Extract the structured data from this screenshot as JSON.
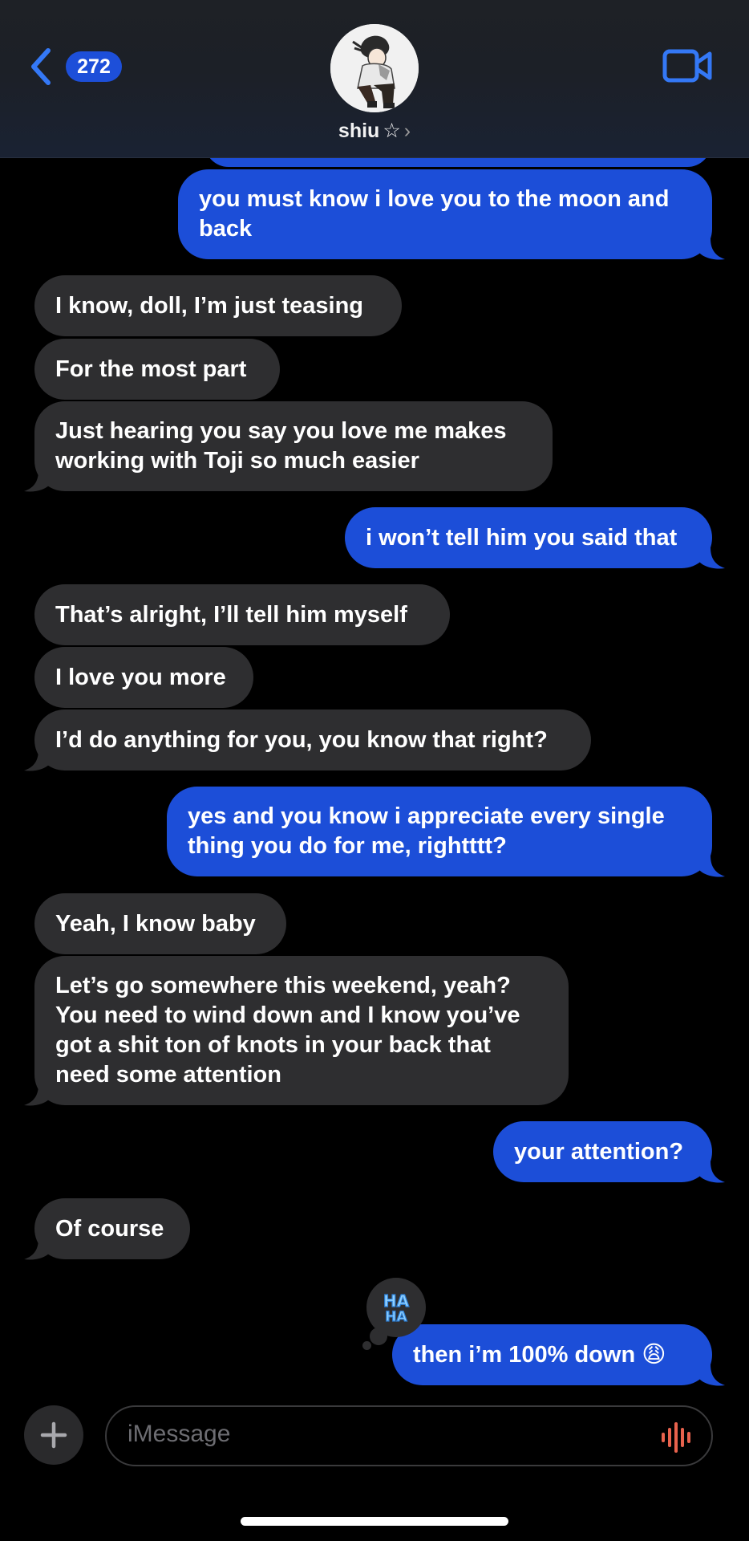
{
  "header": {
    "back_badge": "272",
    "contact_name": "shiu",
    "name_star": "☆",
    "name_chevron": "›"
  },
  "messages": [
    {
      "text": "you must know i love you to the moon and\nback"
    },
    {
      "text": "I know, doll, I’m just teasing"
    },
    {
      "text": "For the most part"
    },
    {
      "text": "Just hearing you say you love me makes\nworking with Toji so much easier"
    },
    {
      "text": "i won’t tell him you said that"
    },
    {
      "text": "That’s alright, I’ll tell him myself"
    },
    {
      "text": "I love you more"
    },
    {
      "text": "I’d do anything for you, you know that right?"
    },
    {
      "text": "yes and you know i appreciate every single\nthing you do for me, rightttt?"
    },
    {
      "text": "Yeah, I know baby"
    },
    {
      "text": "Let’s go somewhere this weekend, yeah?\nYou need to wind down and I know you’ve\ngot a shit ton of knots in your back that\nneed some attention"
    },
    {
      "text": "your attention?"
    },
    {
      "text": "Of course"
    },
    {
      "text": "then i’m 100% down 😩"
    }
  ],
  "tapback": {
    "line1": "HA",
    "line2": "HA"
  },
  "composer": {
    "placeholder": "iMessage"
  },
  "colors": {
    "outgoing": "#1c4ed8",
    "incoming": "#2e2e30",
    "badge": "#1d4fd9",
    "accent": "#3478f6",
    "mic": "#e8624d"
  }
}
